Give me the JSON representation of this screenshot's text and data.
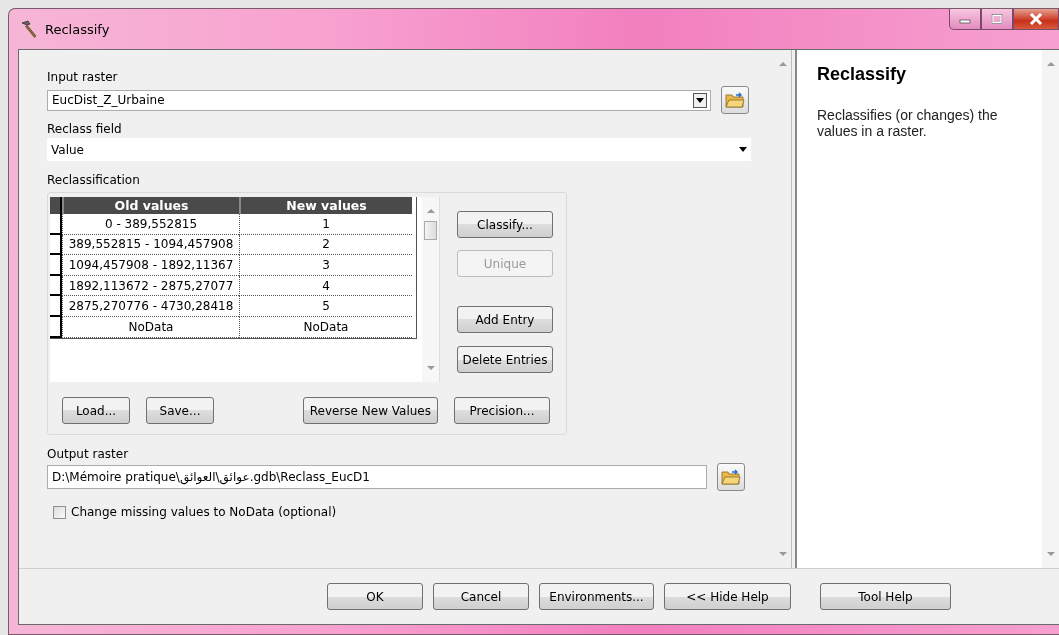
{
  "window": {
    "title": "Reclassify"
  },
  "form": {
    "input_raster": {
      "label": "Input raster",
      "value": "EucDist_Z_Urbaine"
    },
    "reclass_field": {
      "label": "Reclass field",
      "value": "Value"
    },
    "reclassification": {
      "label": "Reclassification",
      "columns": [
        "Old values",
        "New values"
      ],
      "rows": [
        {
          "old": "0 - 389,552815",
          "new": "1"
        },
        {
          "old": "389,552815 - 1094,457908",
          "new": "2"
        },
        {
          "old": "1094,457908 - 1892,11367",
          "new": "3"
        },
        {
          "old": "1892,113672 - 2875,27077",
          "new": "4"
        },
        {
          "old": "2875,270776 - 4730,28418",
          "new": "5"
        },
        {
          "old": "NoData",
          "new": "NoData"
        }
      ],
      "side_buttons": [
        {
          "label": "Classify...",
          "disabled": false
        },
        {
          "label": "Unique",
          "disabled": true
        },
        {
          "label": "Add Entry",
          "disabled": false
        },
        {
          "label": "Delete Entries",
          "disabled": false
        }
      ],
      "bottom_buttons": [
        "Load...",
        "Save...",
        "Reverse New Values",
        "Precision..."
      ]
    },
    "output_raster": {
      "label": "Output raster",
      "value": "D:\\Mémoire pratique\\عوائق\\العوائق.gdb\\Reclass_EucD1"
    },
    "change_missing": {
      "label": "Change missing values to NoData (optional)",
      "checked": false
    }
  },
  "help": {
    "title": "Reclassify",
    "text": "Reclassifies (or changes) the values in a raster."
  },
  "buttons": [
    "OK",
    "Cancel",
    "Environments...",
    "<< Hide Help",
    "Tool Help"
  ]
}
